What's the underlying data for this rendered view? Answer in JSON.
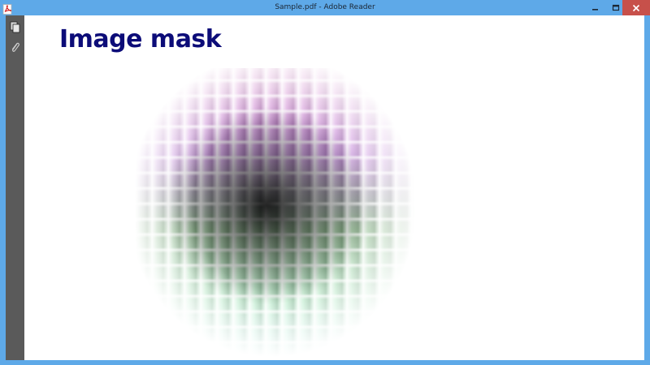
{
  "window": {
    "title": "Sample.pdf - Adobe Reader",
    "app_icon": "adobe-reader-icon",
    "controls": {
      "minimize_icon": "minimize-icon",
      "maximize_icon": "maximize-icon",
      "close_icon": "close-icon",
      "close_color": "#c7504a"
    },
    "frame_color": "#5ea9e8"
  },
  "sidebar": {
    "items": [
      {
        "icon": "page-thumbnails-icon"
      },
      {
        "icon": "attachments-paperclip-icon"
      }
    ],
    "background": "#5a5a5a"
  },
  "document": {
    "heading": "Image mask",
    "heading_color": "#0c0c78",
    "image": {
      "icon": "masked-grid-image",
      "description_colors": [
        "#be3caa",
        "#a03cc8",
        "#3c8c3c",
        "#82dca0"
      ]
    }
  }
}
